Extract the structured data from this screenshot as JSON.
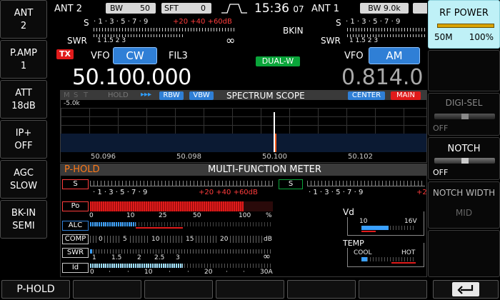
{
  "left_keys": [
    {
      "line1": "ANT",
      "line2": "2"
    },
    {
      "line1": "P.AMP",
      "line2": "1"
    },
    {
      "line1": "ATT",
      "line2": "18dB"
    },
    {
      "line1": "IP+",
      "line2": "OFF"
    },
    {
      "line1": "AGC",
      "line2": "SLOW"
    },
    {
      "line1": "BK-IN",
      "line2": "SEMI"
    }
  ],
  "top": {
    "ant_main": "ANT 2",
    "bw_label": "BW",
    "bw_value": "50",
    "sft_label": "SFT",
    "sft_value": "0",
    "time": "15:36",
    "time_sec": "07",
    "ant_sub": "ANT 1",
    "sub_bw": "BW 9.0k",
    "bkin": "BKIN",
    "dual_w": "DUAL-W"
  },
  "smeter_main": {
    "s": "S",
    "swr": "SWR",
    "s_scale": "· 1 · 3 · 5 · 7 · 9",
    "s_plus": "+20 +40 +60dB",
    "swr_scale": "1    1.5    2    3",
    "inf": "∞"
  },
  "smeter_sub": {
    "s": "S",
    "swr": "SWR",
    "s_scale": "· 1 · 3 · 5 · 7 · 9",
    "swr_scale": "1    1.5    2    3",
    "inf": "∞"
  },
  "vfo_main": {
    "tx": "TX",
    "vfo": "VFO",
    "mode": "CW",
    "filter": "FIL3",
    "freq": "50.100.000"
  },
  "vfo_sub": {
    "vfo": "VFO",
    "mode": "AM",
    "freq": "0.814.0"
  },
  "scope": {
    "title": "SPECTRUM SCOPE",
    "hold": "HOLD",
    "m": "M",
    "s": "S",
    "t": "T",
    "rbw": "RBW",
    "vbw": "VBW",
    "center": "CENTER",
    "main": "MAIN",
    "ref": "-5.0k",
    "ticks": [
      "50.096",
      "50.098",
      "50.100",
      "50.102"
    ]
  },
  "meter": {
    "phold": "P-HOLD",
    "title": "MULTI-FUNCTION METER",
    "s_label": "S",
    "s_scale": "· 1 · 3 · 5 · 7 · 9",
    "s_plus": "+20  +40  +60dB",
    "s_label2": "S",
    "s2_scale": "· 1 · 3 · 5 · 7 · 9",
    "s2_plus": "+2",
    "po": "Po",
    "po_scale": [
      "0",
      "10",
      "25",
      "50",
      "100",
      "%"
    ],
    "alc": "ALC",
    "comp": "COMP",
    "comp_scale": [
      "0",
      "5",
      "10",
      "15",
      "20",
      "dB"
    ],
    "swr": "SWR",
    "swr_scale": [
      "1",
      "1.5",
      "2",
      "2.5",
      "3",
      "∞"
    ],
    "id": "Id",
    "id_scale": [
      "0",
      "·",
      "·",
      "10",
      "·",
      "·",
      "20",
      "·",
      "·",
      "30A"
    ],
    "vd": "Vd",
    "vd_min": "10",
    "vd_max": "16V",
    "temp": "TEMP",
    "cool": "COOL",
    "hot": "HOT",
    "po_level": 1.0,
    "alc_level": 0.25,
    "comp_level": 0.0,
    "vd_level": 0.5,
    "temp_level": 0.1
  },
  "right_keys": {
    "rf_power": "RF POWER",
    "rf_min": "50M",
    "rf_value": "100%",
    "digisel": "DIGI-SEL",
    "digisel_state": "OFF",
    "notch": "NOTCH",
    "notch_state": "OFF",
    "notch_width": "NOTCH WIDTH",
    "notch_width_value": "MID"
  },
  "bottom": {
    "phold": "P-HOLD",
    "back_icon": "return-arrow-icon"
  },
  "colors": {
    "accent_blue": "#2f7fd6",
    "tx_red": "#e11b1b",
    "dual_green": "#0aa53a",
    "highlight_cyan": "#bff1f7",
    "orange": "#ff7a1a"
  }
}
